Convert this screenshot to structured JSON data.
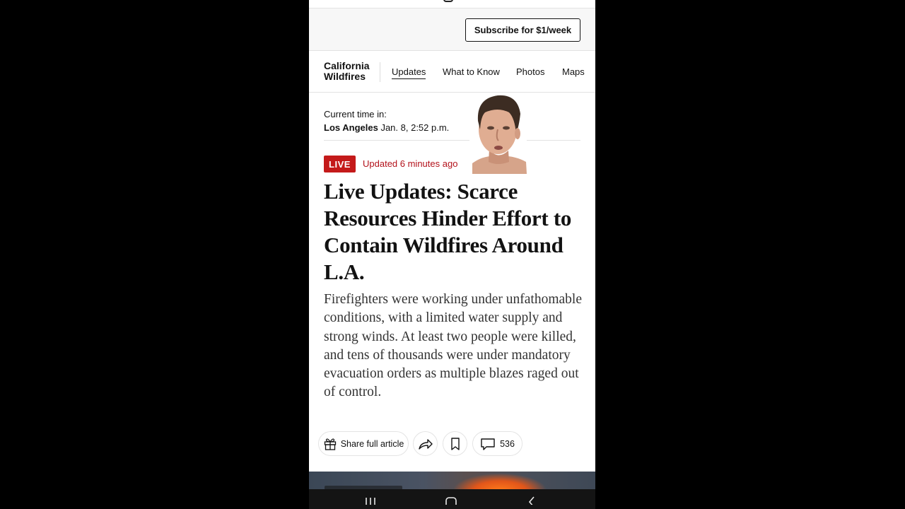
{
  "subscribe": {
    "label": "Subscribe for $1/week"
  },
  "section": {
    "title": "California Wildfires",
    "tabs": [
      {
        "label": "Updates",
        "active": true
      },
      {
        "label": "What to Know",
        "active": false
      },
      {
        "label": "Photos",
        "active": false
      },
      {
        "label": "Maps",
        "active": false
      }
    ]
  },
  "time": {
    "label": "Current time in:",
    "city": "Los Angeles",
    "value": "Jan. 8, 2:52 p.m."
  },
  "live": {
    "badge": "LIVE",
    "updated": "Updated 6 minutes ago"
  },
  "article": {
    "headline": "Live Updates: Scarce Resources Hinder Effort to Contain Wildfires Around L.A.",
    "summary": "Firefighters were working under unfathomable conditions, with a limited water supply and strong winds. At least two people were killed, and tens of thousands were under mandatory evacuation orders as multiple blazes raged out of control."
  },
  "actions": {
    "share_full_label": "Share full article",
    "comment_count": "536"
  },
  "icons": {
    "gift": "gift-icon",
    "share": "share-arrow-icon",
    "bookmark": "bookmark-icon",
    "comment": "comment-icon",
    "recents": "recent-apps-icon",
    "home": "home-icon",
    "back": "back-icon"
  },
  "colors": {
    "live_red": "#c41a1a",
    "updated_red": "#b3121b",
    "ink": "#121212"
  }
}
